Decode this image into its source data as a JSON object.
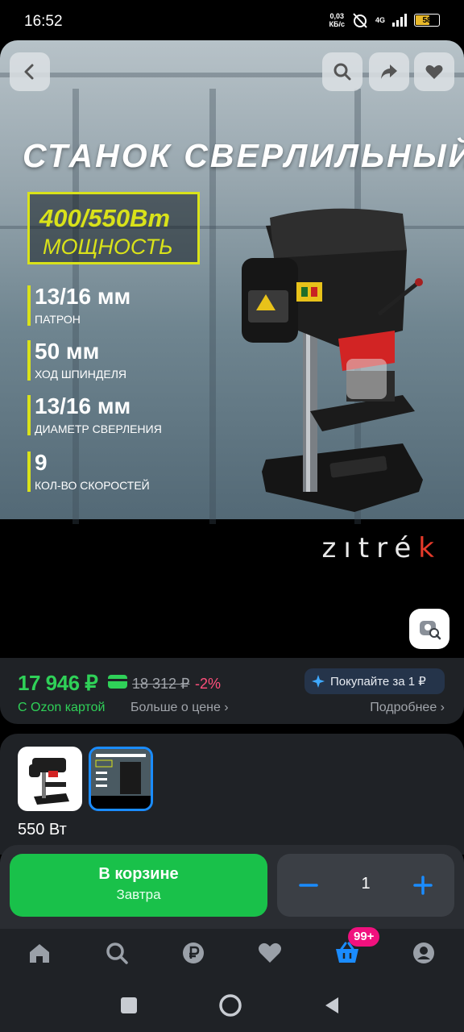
{
  "status_bar": {
    "time": "16:52",
    "speed_value": "0,03",
    "speed_unit": "КБ/с",
    "network": "4G",
    "battery": "58",
    "battery_level": 0.58
  },
  "hero": {
    "title": "СТАНОК СВЕРЛИЛЬНЫЙ",
    "power_value": "400/550Вт",
    "power_label": "МОЩНОСТЬ",
    "specs": [
      {
        "value": "13/16 мм",
        "label": "ПАТРОН"
      },
      {
        "value": "50 мм",
        "label": "ХОД ШПИНДЕЛЯ"
      },
      {
        "value": "13/16 мм",
        "label": "ДИАМЕТР СВЕРЛЕНИЯ"
      },
      {
        "value": "9",
        "label": "КОЛ-ВО СКОРОСТЕЙ"
      }
    ],
    "brand_main": "zıtré",
    "brand_tail": "k"
  },
  "price": {
    "current": "17 946 ₽",
    "old": "18 312 ₽",
    "discount": "-2%",
    "ozon_card_label": "С Ozon картой",
    "more_price_label": "Больше о цене ›",
    "promo_label": "Покупайте за 1 ₽",
    "details_label": "Подробнее ›"
  },
  "variants": {
    "selected_label": "550 Вт"
  },
  "action_bar": {
    "cart_title": "В корзине",
    "cart_subtitle": "Завтра",
    "quantity": "1"
  },
  "tab_bar": {
    "cart_badge": "99+"
  },
  "colors": {
    "accent_green": "#19c14a",
    "price_green": "#2fd158",
    "discount_pink": "#ff4f7b",
    "badge_pink": "#f1117e",
    "blue": "#1a8cff",
    "yellow": "#d9e21a"
  },
  "icons": [
    "back-icon",
    "search-icon",
    "share-icon",
    "heart-icon",
    "photo-search-icon",
    "home-icon",
    "ruble-icon",
    "favorites-icon",
    "cart-icon",
    "profile-icon"
  ]
}
